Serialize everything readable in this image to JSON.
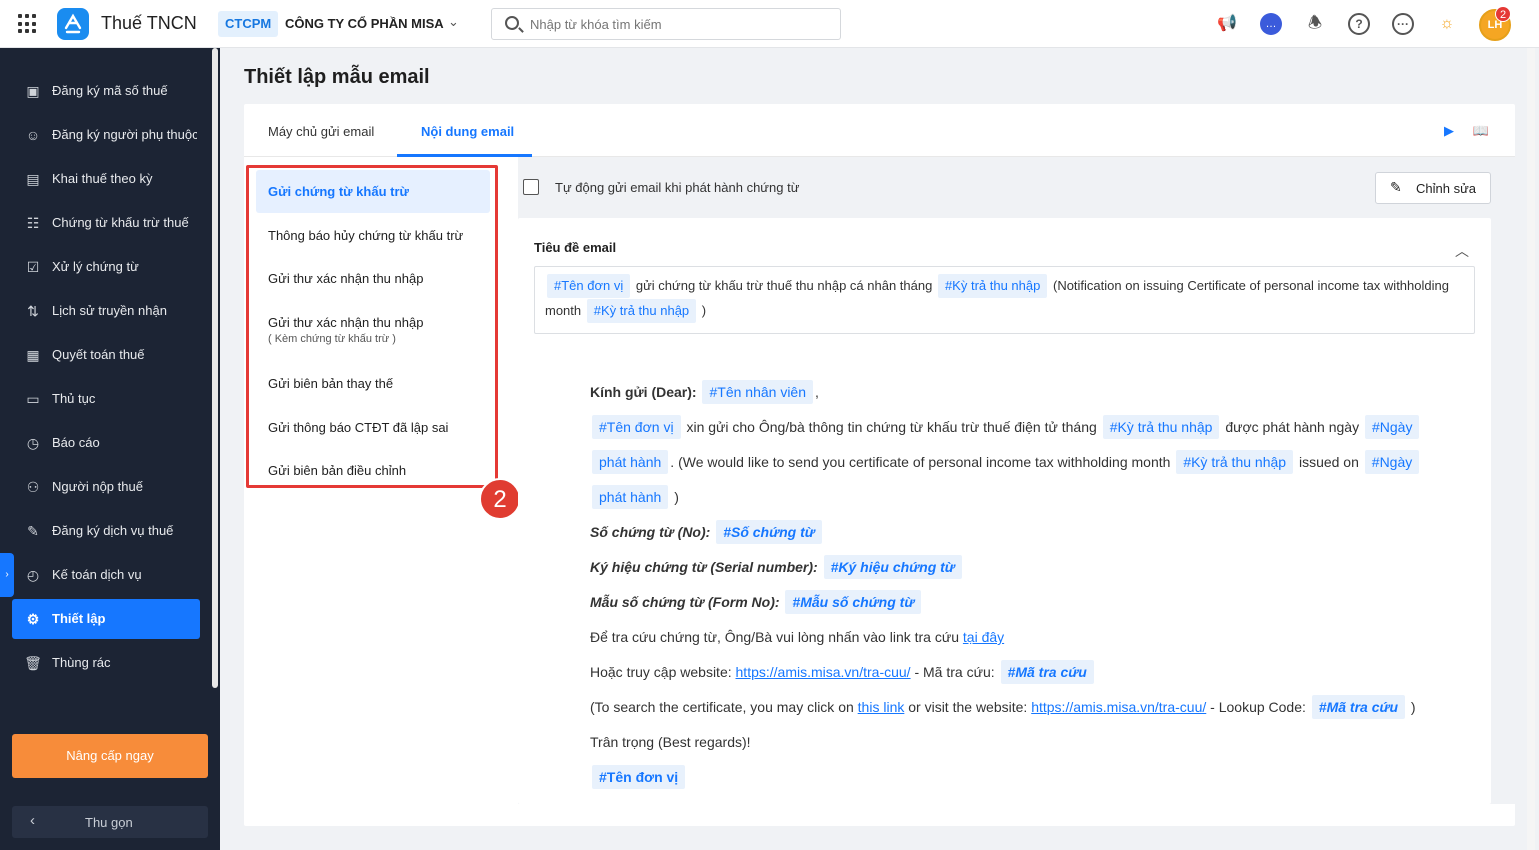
{
  "app": {
    "title": "Thuế TNCN",
    "tenant_tag": "CTCPM",
    "tenant_name": "CÔNG TY CỔ PHẦN MISA"
  },
  "search": {
    "placeholder": "Nhập từ khóa tìm kiếm"
  },
  "header_icons": [
    "megaphone-icon",
    "chat-icon",
    "bell-icon",
    "help-icon",
    "more-icon",
    "light-icon"
  ],
  "user": {
    "avatar_initials": "LH",
    "notification_count": "2"
  },
  "sidebar": {
    "items": [
      {
        "label": "Đăng ký mã số thuế",
        "icon": "id-scan-icon"
      },
      {
        "label": "Đăng ký người phụ thuộc",
        "icon": "users-icon"
      },
      {
        "label": "Khai thuế theo kỳ",
        "icon": "document-icon"
      },
      {
        "label": "Chứng từ khấu trừ thuế",
        "icon": "receipt-icon"
      },
      {
        "label": "Xử lý chứng từ",
        "icon": "check-doc-icon"
      },
      {
        "label": "Lịch sử truyền nhận",
        "icon": "transfer-icon"
      },
      {
        "label": "Quyết toán thuế",
        "icon": "settle-icon"
      },
      {
        "label": "Thủ tục",
        "icon": "procedure-icon"
      },
      {
        "label": "Báo cáo",
        "icon": "report-icon"
      },
      {
        "label": "Người nộp thuế",
        "icon": "person-icon"
      },
      {
        "label": "Đăng ký dịch vụ thuế",
        "icon": "register-icon"
      },
      {
        "label": "Kế toán dịch vụ",
        "icon": "accounting-icon"
      },
      {
        "label": "Thiết lập",
        "icon": "gear-icon"
      },
      {
        "label": "Thùng rác",
        "icon": "trash-icon"
      }
    ],
    "active_index": 12,
    "upgrade_label": "Nâng cấp ngay",
    "collapse_label": "Thu gọn"
  },
  "page": {
    "title": "Thiết lập mẫu email"
  },
  "tabs": [
    {
      "label": "Máy chủ gửi email"
    },
    {
      "label": "Nội dung email"
    }
  ],
  "active_tab": 1,
  "templates": [
    {
      "label": "Gửi chứng từ khấu trừ"
    },
    {
      "label": "Thông báo hủy chứng từ khấu trừ"
    },
    {
      "label": "Gửi thư xác nhận thu nhập"
    },
    {
      "label": "Gửi thư xác nhận thu nhập",
      "sub": "( Kèm chứng từ khấu trừ )"
    },
    {
      "label": "Gửi biên bản thay thế"
    },
    {
      "label": "Gửi thông báo CTĐT đã lập sai"
    },
    {
      "label": "Gửi biên bản điều chỉnh"
    }
  ],
  "annotation_number": "2",
  "auto_send_label": "Tự động gửi email khi phát hành chứng từ",
  "edit_button": "Chỉnh sửa",
  "subject": {
    "label": "Tiêu đề email",
    "tag_unit": "#Tên đơn vị",
    "text1": "gửi chứng từ khấu trừ thuế thu nhập cá nhân tháng",
    "tag_period": "#Kỳ trả thu nhập",
    "text2": "(Notification on issuing Certificate of personal income tax withholding month",
    "text3": ")"
  },
  "body": {
    "dear": "Kính gửi (Dear):",
    "tag_employee": "#Tên nhân viên",
    "comma": ",",
    "tag_unit": "#Tên đơn vị",
    "p1a": "xin gửi cho Ông/bà thông tin chứng từ khấu trừ thuế điện tử tháng",
    "tag_period": "#Kỳ trả thu nhập",
    "p1b": "được phát hành ngày",
    "tag_date_1": "#Ngày",
    "tag_date_2": "phát hành",
    "p1c": ". (We would like to send you certificate of personal income tax withholding month",
    "p1d": "issued on",
    "p1e": ")",
    "no_label": "Số chứng từ (No):",
    "tag_no": "#Số chứng từ",
    "serial_label": "Ký hiệu chứng từ (Serial number):",
    "tag_serial": "#Ký hiệu chứng từ",
    "form_label": "Mẫu số chứng từ (Form No):",
    "tag_form": "#Mẫu số chứng từ",
    "lookup_text": "Để tra cứu chứng từ, Ông/Bà vui lòng nhấn vào link tra cứu",
    "lookup_link": "tại đây",
    "visit_text": "Hoặc truy cập website:",
    "site_url": "https://amis.misa.vn/tra-cuu/",
    "code_text": "- Mã tra cứu:",
    "tag_code": "#Mã tra cứu",
    "en_text1": "(To search the certificate, you may click on",
    "en_link": "this link",
    "en_text2": "or visit the website:",
    "en_code": "- Lookup Code:",
    "en_close": ")",
    "regards": "Trân trọng (Best regards)!"
  }
}
